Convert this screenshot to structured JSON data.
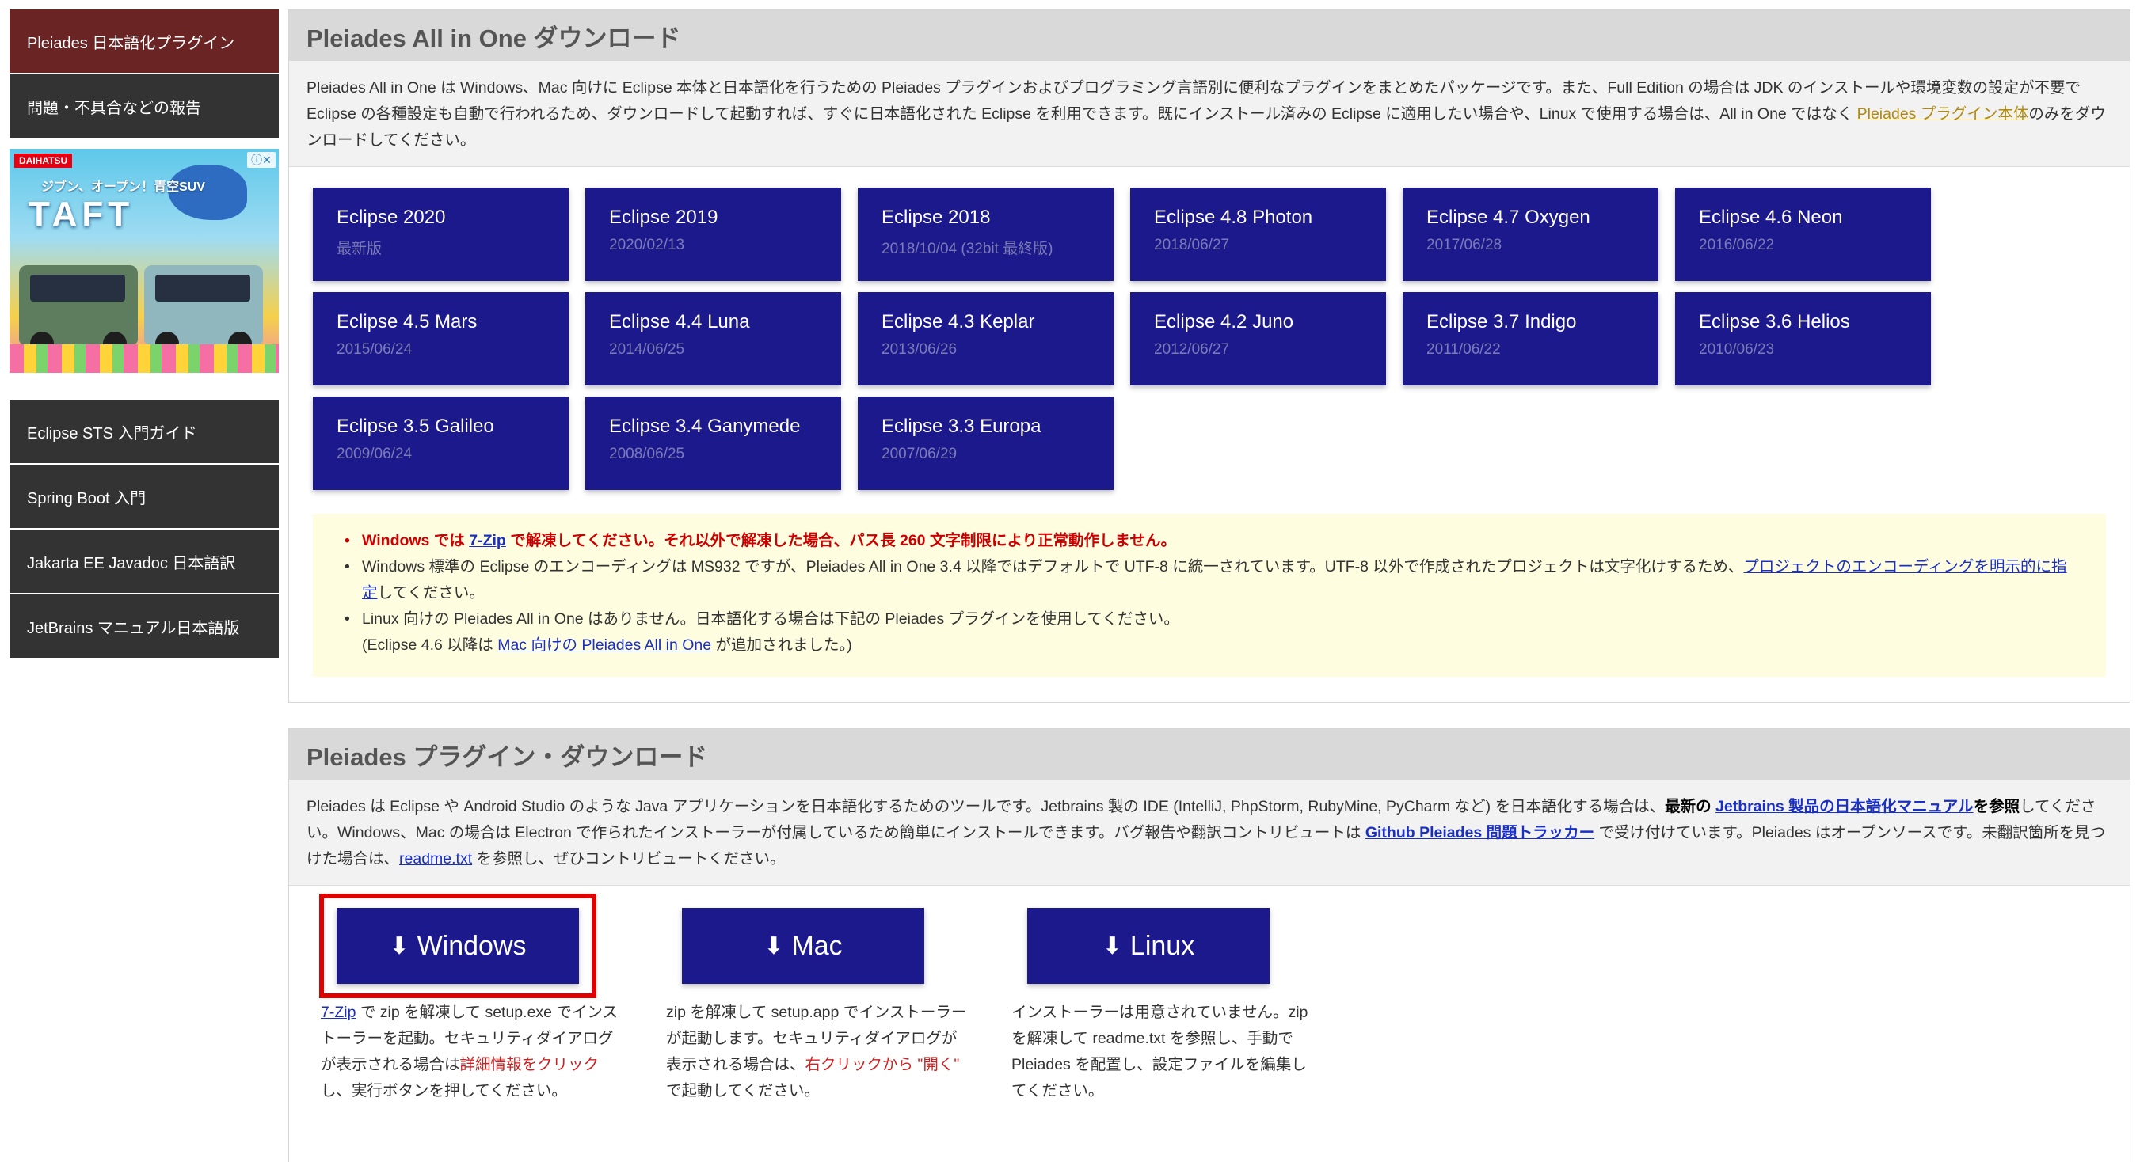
{
  "sidebar": {
    "top_items": [
      "Pleiades 日本語化プラグイン",
      "問題・不具合などの報告"
    ],
    "bottom_items": [
      "Eclipse STS 入門ガイド",
      "Spring Boot 入門",
      "Jakarta EE Javadoc 日本語訳",
      "JetBrains マニュアル日本語版"
    ],
    "ad": {
      "brand": "DAIHATSU",
      "close": "ⓘ✕",
      "headline": "ジブン、オープン！青空SUV",
      "logo": "TAFT"
    }
  },
  "allinone": {
    "title": "Pleiades All in One ダウンロード",
    "desc_1": "Pleiades All in One は Windows、Mac 向けに Eclipse 本体と日本語化を行うための Pleiades プラグインおよびプログラミング言語別に便利なプラグインをまとめたパッケージです。また、Full Edition の場合は JDK のインストールや環境変数の設定が不要で Eclipse の各種設定も自動で行われるため、ダウンロードして起動すれば、すぐに日本語化された Eclipse を利用できます。既にインストール済みの Eclipse に適用したい場合や、Linux で使用する場合は、All in One ではなく ",
    "desc_link": "Pleiades プラグイン本体",
    "desc_2": "のみをダウンロードしてください。",
    "versions": [
      {
        "name": "Eclipse 2020",
        "date": "最新版"
      },
      {
        "name": "Eclipse 2019",
        "date": "2020/02/13"
      },
      {
        "name": "Eclipse 2018",
        "date": "2018/10/04 (32bit 最終版)"
      },
      {
        "name": "Eclipse 4.8 Photon",
        "date": "2018/06/27"
      },
      {
        "name": "Eclipse 4.7 Oxygen",
        "date": "2017/06/28"
      },
      {
        "name": "Eclipse 4.6 Neon",
        "date": "2016/06/22"
      },
      {
        "name": "Eclipse 4.5 Mars",
        "date": "2015/06/24"
      },
      {
        "name": "Eclipse 4.4 Luna",
        "date": "2014/06/25"
      },
      {
        "name": "Eclipse 4.3 Keplar",
        "date": "2013/06/26"
      },
      {
        "name": "Eclipse 4.2 Juno",
        "date": "2012/06/27"
      },
      {
        "name": "Eclipse 3.7 Indigo",
        "date": "2011/06/22"
      },
      {
        "name": "Eclipse 3.6 Helios",
        "date": "2010/06/23"
      },
      {
        "name": "Eclipse 3.5 Galileo",
        "date": "2009/06/24"
      },
      {
        "name": "Eclipse 3.4 Ganymede",
        "date": "2008/06/25"
      },
      {
        "name": "Eclipse 3.3 Europa",
        "date": "2007/06/29"
      }
    ],
    "notes": {
      "warn_1": "Windows では ",
      "warn_link": "7-Zip",
      "warn_2": " で解凍してください。それ以外で解凍した場合、パス長 260 文字制限により正常動作しません。",
      "enc_1": "Windows 標準の Eclipse のエンコーディングは MS932 ですが、Pleiades All in One 3.4 以降ではデフォルトで UTF-8 に統一されています。UTF-8 以外で作成されたプロジェクトは文字化けするため、",
      "enc_link": "プロジェクトのエンコーディングを明示的に指定",
      "enc_2": "してください。",
      "linux_1": "Linux 向けの Pleiades All in One はありません。日本語化する場合は下記の Pleiades プラグインを使用してください。",
      "linux_2a": "(Eclipse 4.6 以降は ",
      "linux_link": "Mac 向けの Pleiades All in One",
      "linux_2b": " が追加されました。)"
    }
  },
  "plugin": {
    "title": "Pleiades プラグイン・ダウンロード",
    "desc_1": "Pleiades は Eclipse や Android Studio のような Java アプリケーションを日本語化するためのツールです。Jetbrains 製の IDE (IntelliJ, PhpStorm, RubyMine, PyCharm など) を日本語化する場合は、",
    "desc_bold_1": "最新の ",
    "desc_link_1": "Jetbrains 製品の日本語化マニュアル",
    "desc_bold_2": "を参照",
    "desc_2": "してください。Windows、Mac の場合は Electron で作られたインストーラーが付属しているため簡単にインストールできます。バグ報告や翻訳コントリビュートは ",
    "desc_link_2": "Github Pleiades 問題トラッカー",
    "desc_3": " で受け付けています。Pleiades はオープンソースです。未翻訳箇所を見つけた場合は、",
    "desc_link_3": "readme.txt",
    "desc_4": " を参照し、ぜひコントリビュートください。",
    "buttons": {
      "windows": "Windows",
      "mac": "Mac",
      "linux": "Linux"
    },
    "win_note_link": "7-Zip",
    "win_note_1": " で zip を解凍して setup.exe でインストーラーを起動。セキュリティダイアログが表示される場合は",
    "win_note_red": "詳細情報をクリック",
    "win_note_2": "し、実行ボタンを押してください。",
    "mac_note_1": "zip を解凍して setup.app でインストーラーが起動します。セキュリティダイアログが表示される場合は、",
    "mac_note_red": "右クリックから \"開く\"",
    "mac_note_2": " で起動してください。",
    "linux_note": "インストーラーは用意されていません。zip を解凍して readme.txt を参照し、手動で Pleiades を配置し、設定ファイルを編集してください。"
  }
}
